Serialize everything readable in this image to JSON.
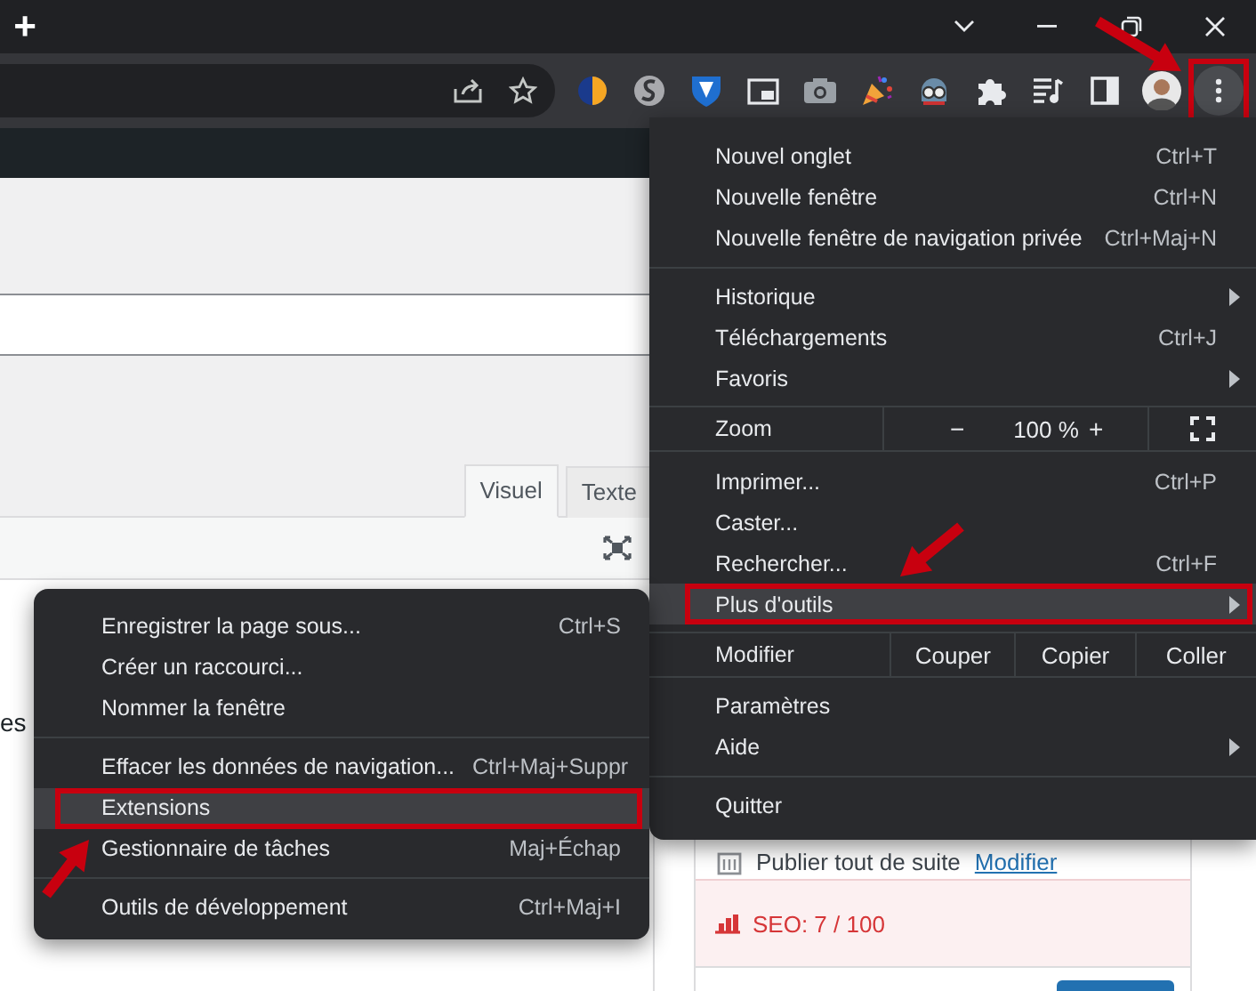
{
  "window": {
    "new_tab_label": "+"
  },
  "toolbar": {
    "menu_button": {
      "highlighted": true
    }
  },
  "page": {
    "editor_tabs": [
      {
        "label": "Visuel",
        "selected": true
      },
      {
        "label": "Texte",
        "selected": false
      }
    ],
    "cut_text": "es",
    "publish": {
      "text": "Publier tout de suite",
      "link": "Modifier"
    },
    "seo_score": "SEO: 7 / 100"
  },
  "menu": {
    "items": [
      {
        "kind": "item",
        "label": "Nouvel onglet",
        "shortcut": "Ctrl+T",
        "submenu": false,
        "highlighted": false
      },
      {
        "kind": "item",
        "label": "Nouvelle fenêtre",
        "shortcut": "Ctrl+N",
        "submenu": false,
        "highlighted": false
      },
      {
        "kind": "item",
        "label": "Nouvelle fenêtre de navigation privée",
        "shortcut": "Ctrl+Maj+N",
        "submenu": false,
        "highlighted": false
      },
      {
        "kind": "separator"
      },
      {
        "kind": "item",
        "label": "Historique",
        "submenu": true,
        "highlighted": false
      },
      {
        "kind": "item",
        "label": "Téléchargements",
        "shortcut": "Ctrl+J",
        "submenu": false,
        "highlighted": false
      },
      {
        "kind": "item",
        "label": "Favoris",
        "submenu": true,
        "highlighted": false
      },
      {
        "kind": "zoom",
        "label": "Zoom",
        "minus": "−",
        "value": "100 %",
        "plus": "+"
      },
      {
        "kind": "item",
        "label": "Imprimer...",
        "shortcut": "Ctrl+P",
        "submenu": false,
        "highlighted": false
      },
      {
        "kind": "item",
        "label": "Caster...",
        "submenu": false,
        "highlighted": false
      },
      {
        "kind": "item",
        "label": "Rechercher...",
        "shortcut": "Ctrl+F",
        "submenu": false,
        "highlighted": false
      },
      {
        "kind": "item",
        "label": "Plus d'outils",
        "submenu": true,
        "highlighted": true
      },
      {
        "kind": "edit",
        "label": "Modifier",
        "buttons": [
          "Couper",
          "Copier",
          "Coller"
        ]
      },
      {
        "kind": "item",
        "label": "Paramètres",
        "submenu": false,
        "highlighted": false
      },
      {
        "kind": "item",
        "label": "Aide",
        "submenu": true,
        "highlighted": false
      },
      {
        "kind": "separator"
      },
      {
        "kind": "item",
        "label": "Quitter",
        "submenu": false,
        "highlighted": false
      }
    ]
  },
  "submenu": {
    "items": [
      {
        "kind": "item",
        "label": "Enregistrer la page sous...",
        "shortcut": "Ctrl+S",
        "highlighted": false
      },
      {
        "kind": "item",
        "label": "Créer un raccourci...",
        "highlighted": false
      },
      {
        "kind": "item",
        "label": "Nommer la fenêtre",
        "highlighted": false
      },
      {
        "kind": "separator"
      },
      {
        "kind": "item",
        "label": "Effacer les données de navigation...",
        "shortcut": "Ctrl+Maj+Suppr",
        "highlighted": false
      },
      {
        "kind": "item",
        "label": "Extensions",
        "highlighted": true
      },
      {
        "kind": "item",
        "label": "Gestionnaire de tâches",
        "shortcut": "Maj+Échap",
        "highlighted": false
      },
      {
        "kind": "separator"
      },
      {
        "kind": "item",
        "label": "Outils de développement",
        "shortcut": "Ctrl+Maj+I",
        "highlighted": false
      }
    ]
  }
}
